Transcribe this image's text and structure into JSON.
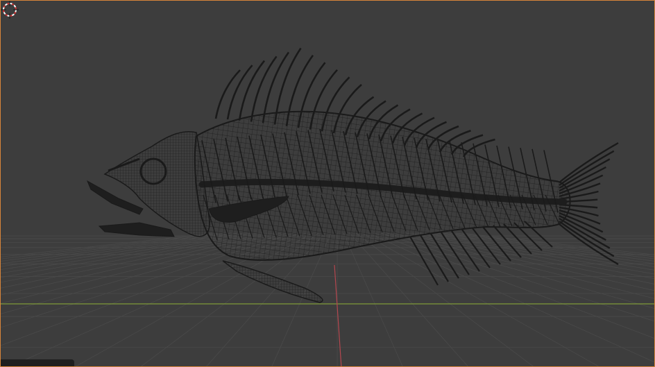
{
  "viewport": {
    "mode": "wireframe",
    "background_color": "#3d3d3d",
    "active_border_color": "#d8853a",
    "grid_color": "#4a4a4a",
    "x_axis_color": "#7f9a3a",
    "y_axis_color": "#b5474f",
    "wire_color": "#1a1a1a"
  },
  "scene": {
    "object": "fish-skeleton-mesh",
    "cursor": "3d-cursor-icon"
  }
}
